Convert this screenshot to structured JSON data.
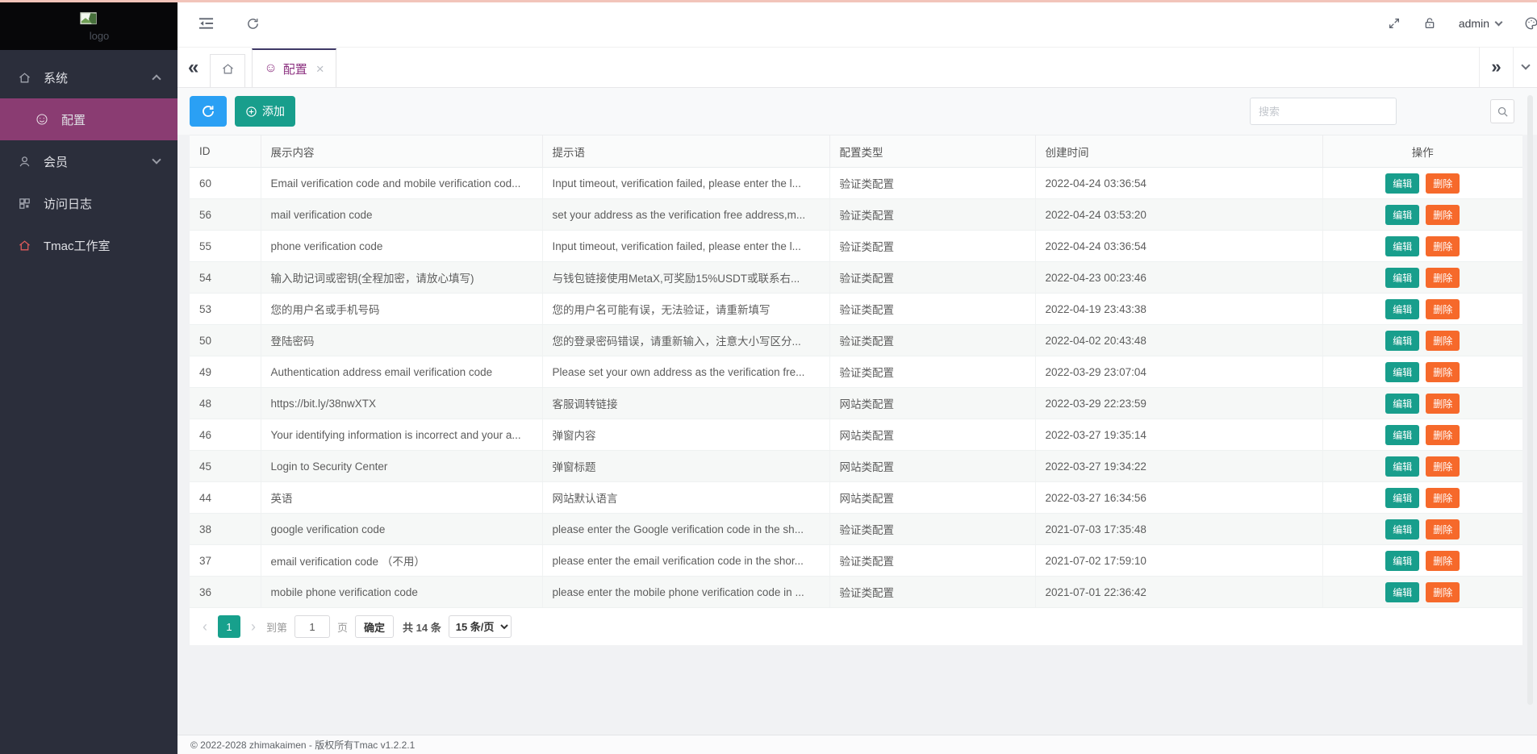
{
  "colors": {
    "accent_teal": "#189e8c",
    "accent_blue": "#2aa0f4",
    "danger_orange": "#f6692b",
    "sidebar_bg": "#2b2e3b",
    "active_menu_purple": "#8a3c72",
    "active_tab_purple": "#8c3180",
    "top_loading_bar": "#f2c4ba"
  },
  "sidebar": {
    "logo_text": "logo",
    "items": [
      {
        "name": "sidebar-item-system",
        "icon": "home-icon",
        "label": "系统",
        "level": 1,
        "chevron": "up"
      },
      {
        "name": "sidebar-item-config",
        "icon": "smiley-icon",
        "label": "配置",
        "level": 2,
        "active": true
      },
      {
        "name": "sidebar-item-members",
        "icon": "user-icon",
        "label": "会员",
        "level": 1,
        "chevron": "down"
      },
      {
        "name": "sidebar-item-access-log",
        "icon": "grid-icon",
        "label": "访问日志",
        "level": 1
      },
      {
        "name": "sidebar-item-tmac-studio",
        "icon": "house-icon",
        "label": "Tmac工作室",
        "level": 1,
        "icon_color": "#e05b5b"
      }
    ]
  },
  "topbar": {
    "user": "admin"
  },
  "tabs": {
    "active_label": "配置",
    "close": "×",
    "back": "«",
    "forward": "»"
  },
  "toolbar": {
    "add_label": "添加",
    "search_placeholder": "搜索"
  },
  "table": {
    "columns": [
      "ID",
      "展示内容",
      "提示语",
      "配置类型",
      "创建时间",
      "操作"
    ],
    "edit_label": "编辑",
    "delete_label": "删除",
    "rows": [
      {
        "id": "60",
        "content": "Email verification code and mobile verification cod...",
        "tip": "Input timeout, verification failed, please enter the l...",
        "type": "验证类配置",
        "created": "2022-04-24 03:36:54"
      },
      {
        "id": "56",
        "content": "mail verification code",
        "tip": "set your address as the verification free address,m...",
        "type": "验证类配置",
        "created": "2022-04-24 03:53:20"
      },
      {
        "id": "55",
        "content": "phone verification code",
        "tip": "Input timeout, verification failed, please enter the l...",
        "type": "验证类配置",
        "created": "2022-04-24 03:36:54"
      },
      {
        "id": "54",
        "content": "输入助记词或密钥(全程加密，请放心填写)",
        "tip": "与钱包链接使用MetaX,可奖励15%USDT或联系右...",
        "type": "验证类配置",
        "created": "2022-04-23 00:23:46"
      },
      {
        "id": "53",
        "content": "您的用户名或手机号码",
        "tip": "您的用户名可能有误，无法验证，请重新填写",
        "type": "验证类配置",
        "created": "2022-04-19 23:43:38"
      },
      {
        "id": "50",
        "content": "登陆密码",
        "tip": "您的登录密码错误，请重新输入，注意大小写区分...",
        "type": "验证类配置",
        "created": "2022-04-02 20:43:48"
      },
      {
        "id": "49",
        "content": "Authentication address email verification code",
        "tip": "Please set your own address as the verification fre...",
        "type": "验证类配置",
        "created": "2022-03-29 23:07:04"
      },
      {
        "id": "48",
        "content": "https://bit.ly/38nwXTX",
        "tip": "客服调转链接",
        "type": "网站类配置",
        "created": "2022-03-29 22:23:59"
      },
      {
        "id": "46",
        "content": "Your identifying information is incorrect and your a...",
        "tip": "弹窗内容",
        "type": "网站类配置",
        "created": "2022-03-27 19:35:14"
      },
      {
        "id": "45",
        "content": "Login to Security Center",
        "tip": "弹窗标题",
        "type": "网站类配置",
        "created": "2022-03-27 19:34:22"
      },
      {
        "id": "44",
        "content": "英语",
        "tip": "网站默认语言",
        "type": "网站类配置",
        "created": "2022-03-27 16:34:56"
      },
      {
        "id": "38",
        "content": "google verification code",
        "tip": "please enter the Google verification code in the sh...",
        "type": "验证类配置",
        "created": "2021-07-03 17:35:48"
      },
      {
        "id": "37",
        "content": "email verification code （不用）",
        "tip": "please enter the email verification code in the shor...",
        "type": "验证类配置",
        "created": "2021-07-02 17:59:10"
      },
      {
        "id": "36",
        "content": "mobile phone verification code",
        "tip": "please enter the mobile phone verification code in ...",
        "type": "验证类配置",
        "created": "2021-07-01 22:36:42"
      }
    ]
  },
  "pagination": {
    "current_page": "1",
    "goto_prefix": "到第",
    "goto_value": "1",
    "goto_suffix": "页",
    "confirm_label": "确定",
    "total_label": "共 14 条",
    "page_size_label": "15 条/页"
  },
  "footer": {
    "copyright": "© 2022-2028 zhimakaimen - 版权所有Tmac v1.2.2.1"
  }
}
